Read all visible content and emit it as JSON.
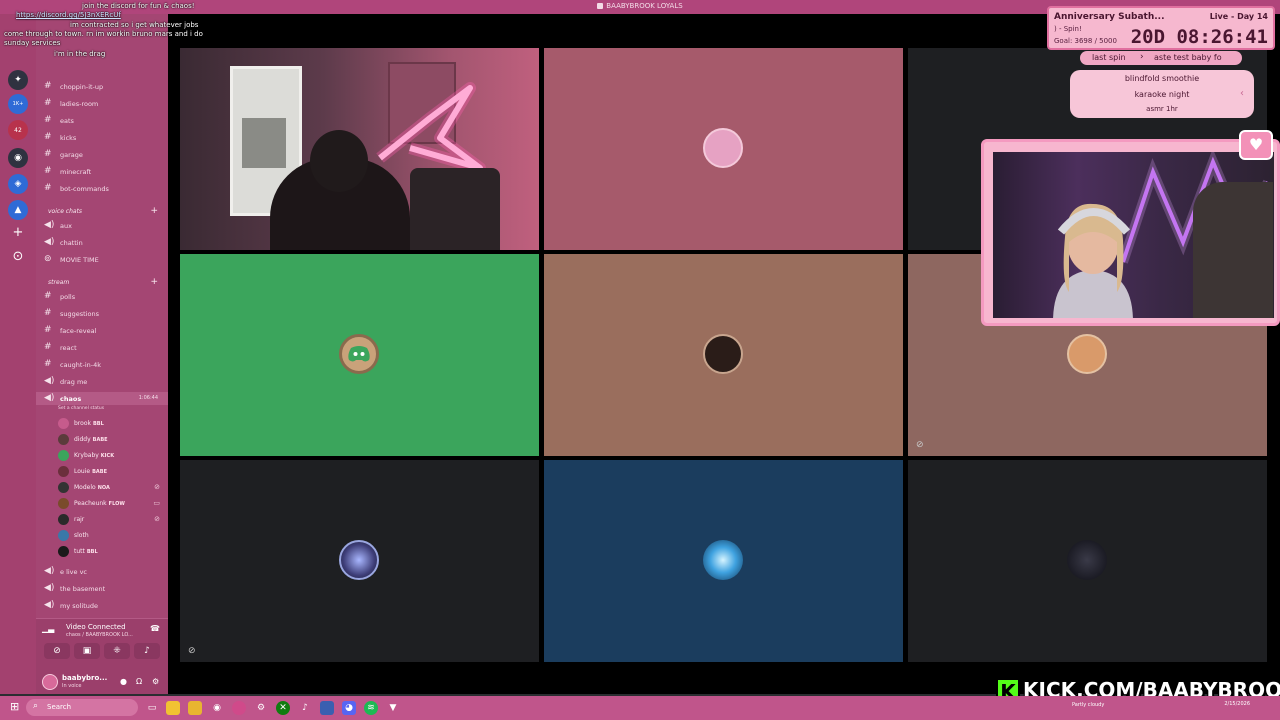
{
  "window": {
    "title": "BAABYBROOK LOYALS"
  },
  "chat": {
    "lines": [
      {
        "user": "",
        "text": "join the discord for fun & chaos!"
      },
      {
        "user": "",
        "text": "https://discord.gg/5J3nXERcUf"
      },
      {
        "user": "",
        "text": "im contracted so i get whatever jobs"
      },
      {
        "user": "",
        "text": "come through to town. rn im workin bruno mars and i do"
      },
      {
        "user": "",
        "text": "sunday services"
      },
      {
        "user": "",
        "text": "i'm in the drag"
      }
    ]
  },
  "rail": {
    "badges": [
      "1K+",
      "42"
    ]
  },
  "sidebar": {
    "channels": [
      {
        "name": "choppin-it-up"
      },
      {
        "name": "ladies-room"
      },
      {
        "name": "eats"
      },
      {
        "name": "kicks"
      },
      {
        "name": "garage"
      },
      {
        "name": "minecraft"
      },
      {
        "name": "bot-commands"
      }
    ],
    "voice_category": "voice chats",
    "voice_channels": [
      {
        "name": "aux"
      },
      {
        "name": "chattin"
      },
      {
        "name": "MOVIE TIME"
      }
    ],
    "stream_category": "stream",
    "stream_channels": [
      {
        "name": "polls"
      },
      {
        "name": "suggestions"
      },
      {
        "name": "face-reveal"
      },
      {
        "name": "react"
      },
      {
        "name": "caught-in-4k"
      },
      {
        "name": "drag me"
      }
    ],
    "active_channel": {
      "name": "chaos",
      "time": "1:06:44",
      "status": "Set a channel status"
    },
    "members": [
      {
        "name": "brook",
        "badge": "BBL",
        "color": "#c65b8c"
      },
      {
        "name": "diddy",
        "badge": "BABE",
        "color": "#5a3b3b"
      },
      {
        "name": "Krybaby",
        "badge": "KICK",
        "color": "#3ba55c"
      },
      {
        "name": "Louie",
        "badge": "BABE",
        "color": "#6b2f3c"
      },
      {
        "name": "Modelo",
        "badge": "NOA",
        "color": "#333333"
      },
      {
        "name": "Peacheunk",
        "badge": "FLOW",
        "color": "#7a4b2b"
      },
      {
        "name": "rajr",
        "badge": "",
        "color": "#2a2a2a"
      },
      {
        "name": "sloth",
        "badge": "",
        "color": "#3a78a8"
      },
      {
        "name": "tutt",
        "badge": "BBL",
        "color": "#1a1a1a"
      }
    ],
    "extra_channels": [
      {
        "name": "e live vc"
      },
      {
        "name": "the basement"
      },
      {
        "name": "my solitude"
      }
    ]
  },
  "voice_panel": {
    "status": "Video Connected",
    "sub": "chaos / BAABYBROOK LO...",
    "user": "baabybro...",
    "user_status": "In voice"
  },
  "subathon": {
    "title": "Anniversary Subath...",
    "live": "Live - Day 14",
    "spin": ") - Spin!",
    "goal": "Goal: 3698 / 5000",
    "timer": "20D 08:26:41"
  },
  "spin": {
    "last_label": "last spin",
    "last_value": "aste test baby fo",
    "options": [
      "blindfold smoothie",
      "karaoke night",
      "asmr 1hr"
    ]
  },
  "footer": {
    "kick_url": "KICK.COM/BAABYBROOK"
  },
  "taskbar": {
    "search": "Search",
    "weather": "Partly cloudy",
    "date": "2/15/2026"
  },
  "colors": {
    "green_tile": "#3ba55c",
    "pink_tile": "#a65a6b",
    "brown_tile": "#9a6e5d",
    "dark_tile": "#1e1f22",
    "blue_tile": "#1b3d5e",
    "brown_tile_2": "#8e6760"
  }
}
